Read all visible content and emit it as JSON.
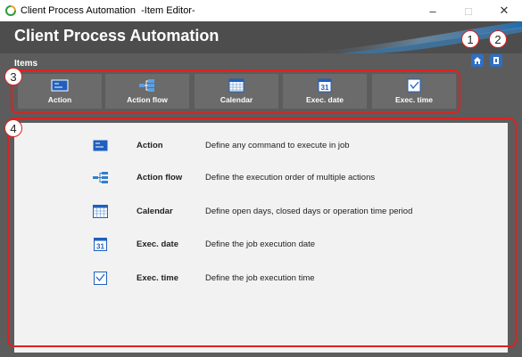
{
  "window": {
    "title": "Client Process Automation  -Item Editor-",
    "minimize": "–",
    "maximize": "□",
    "close": "✕"
  },
  "header": {
    "app_title": "Client Process Automation",
    "items_label": "Items",
    "home_icon": "home-icon",
    "help_icon": "help-book-icon"
  },
  "toolbar": {
    "buttons": [
      {
        "label": "Action",
        "icon": "action-icon"
      },
      {
        "label": "Action flow",
        "icon": "action-flow-icon"
      },
      {
        "label": "Calendar",
        "icon": "calendar-icon"
      },
      {
        "label": "Exec. date",
        "icon": "exec-date-icon"
      },
      {
        "label": "Exec. time",
        "icon": "exec-time-icon"
      }
    ]
  },
  "main": {
    "rows": [
      {
        "name": "Action",
        "desc": "Define any command to execute in job"
      },
      {
        "name": "Action flow",
        "desc": "Define the execution order of multiple actions"
      },
      {
        "name": "Calendar",
        "desc": "Define open days, closed days or operation time period"
      },
      {
        "name": "Exec. date",
        "desc": "Define the job execution date"
      },
      {
        "name": "Exec. time",
        "desc": "Define the job execution time"
      }
    ]
  },
  "callouts": [
    "1",
    "2",
    "3",
    "4"
  ],
  "colors": {
    "accent_blue": "#1f5fbf",
    "callout_red": "#e02020",
    "panel_gray": "#5c5c5c",
    "content_bg": "#f2f2f2"
  }
}
